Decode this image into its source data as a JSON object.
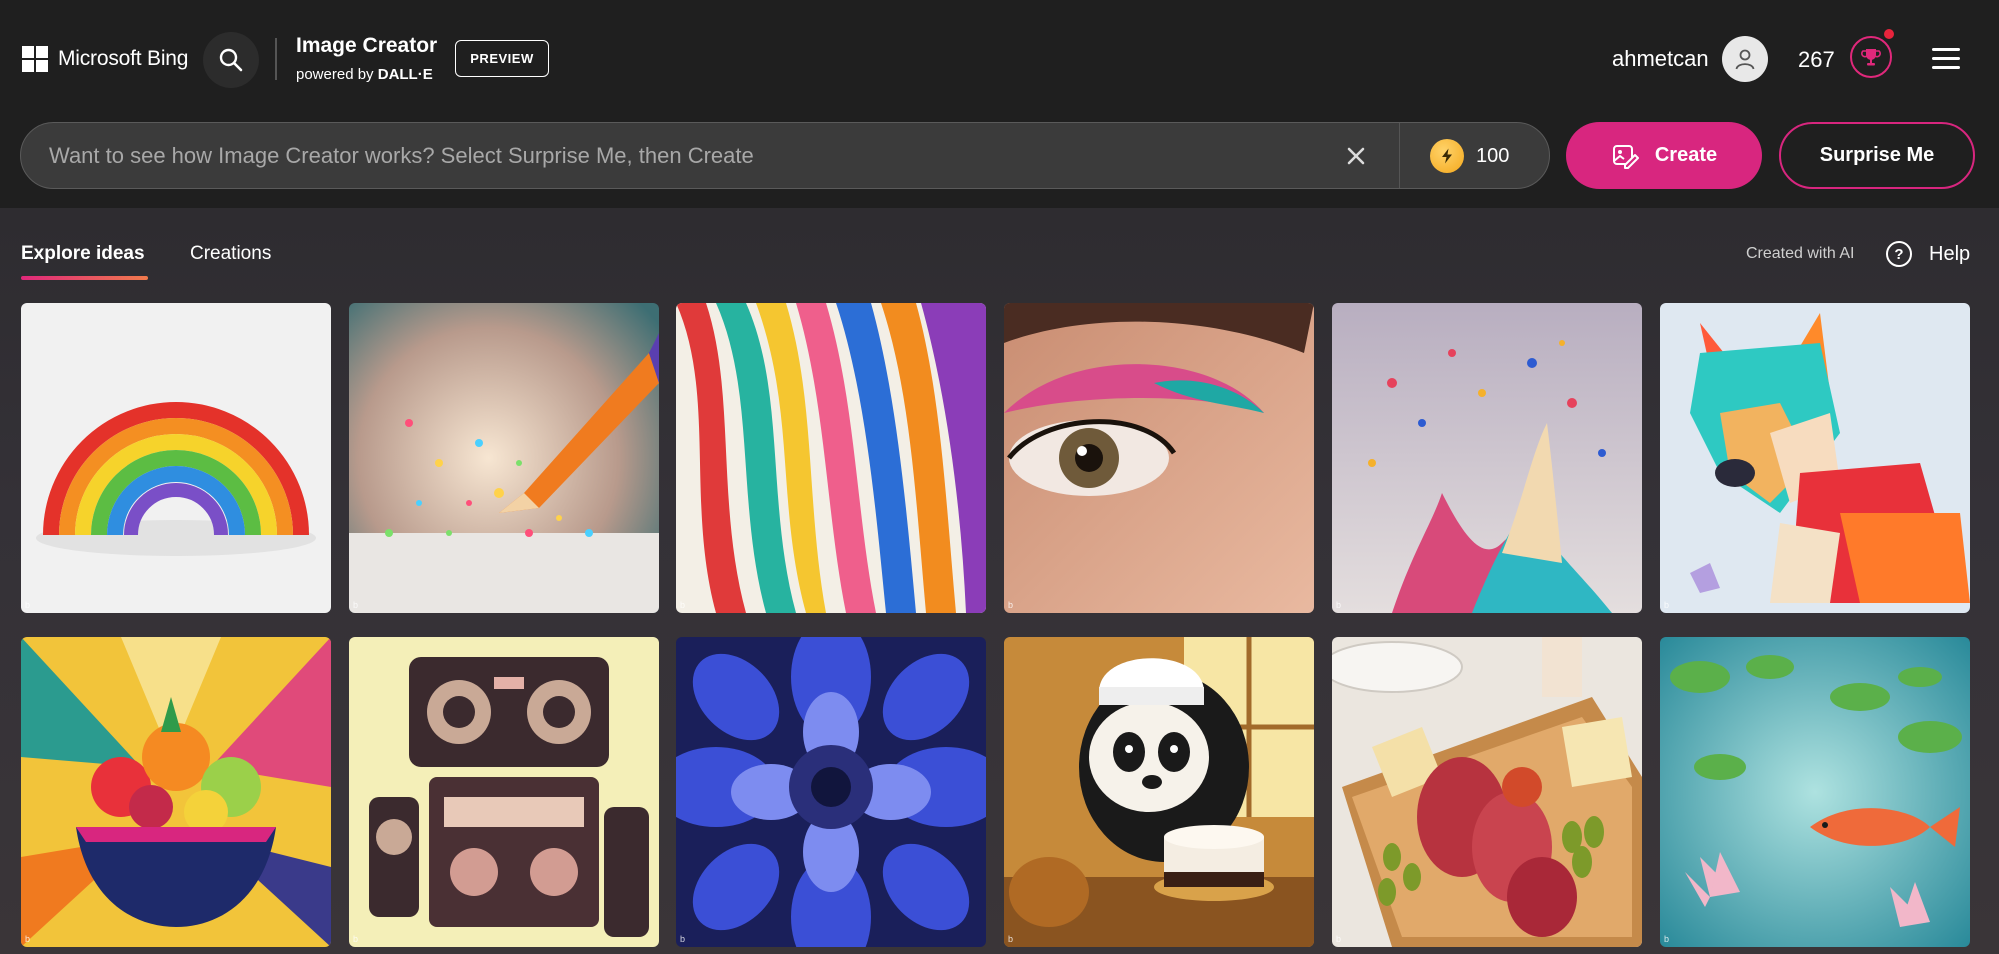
{
  "header": {
    "brand": "Microsoft Bing",
    "product_title": "Image Creator",
    "product_sub_prefix": "powered by",
    "product_sub_brand": "DALL·E",
    "badge": "PREVIEW",
    "username": "ahmetcan",
    "points": "267",
    "icons": [
      "windows-logo-icon",
      "search-icon",
      "user-icon",
      "trophy-icon",
      "hamburger-menu-icon"
    ]
  },
  "search": {
    "placeholder": "Want to see how Image Creator works? Select Surprise Me, then Create",
    "value": "",
    "boosts": "100"
  },
  "actions": {
    "create": "Create",
    "surprise": "Surprise Me"
  },
  "tabs": {
    "explore": "Explore ideas",
    "creations": "Creations",
    "created_with_ai": "Created with AI",
    "help": "Help"
  },
  "colors": {
    "accent": "#d8267f",
    "topbar": "#1f1f1f",
    "background": "#2e2c30"
  },
  "gallery": [
    {
      "subject": "paper-rainbow-image"
    },
    {
      "subject": "pencil-glitter-image"
    },
    {
      "subject": "colorful-ribbons-image"
    },
    {
      "subject": "eye-makeup-image"
    },
    {
      "subject": "paint-splash-image"
    },
    {
      "subject": "paper-fox-image"
    },
    {
      "subject": "fruit-bowl-image"
    },
    {
      "subject": "boombox-robot-image"
    },
    {
      "subject": "blue-dahlia-image"
    },
    {
      "subject": "panda-chef-image"
    },
    {
      "subject": "charcuterie-board-image"
    },
    {
      "subject": "koi-pond-image"
    }
  ]
}
